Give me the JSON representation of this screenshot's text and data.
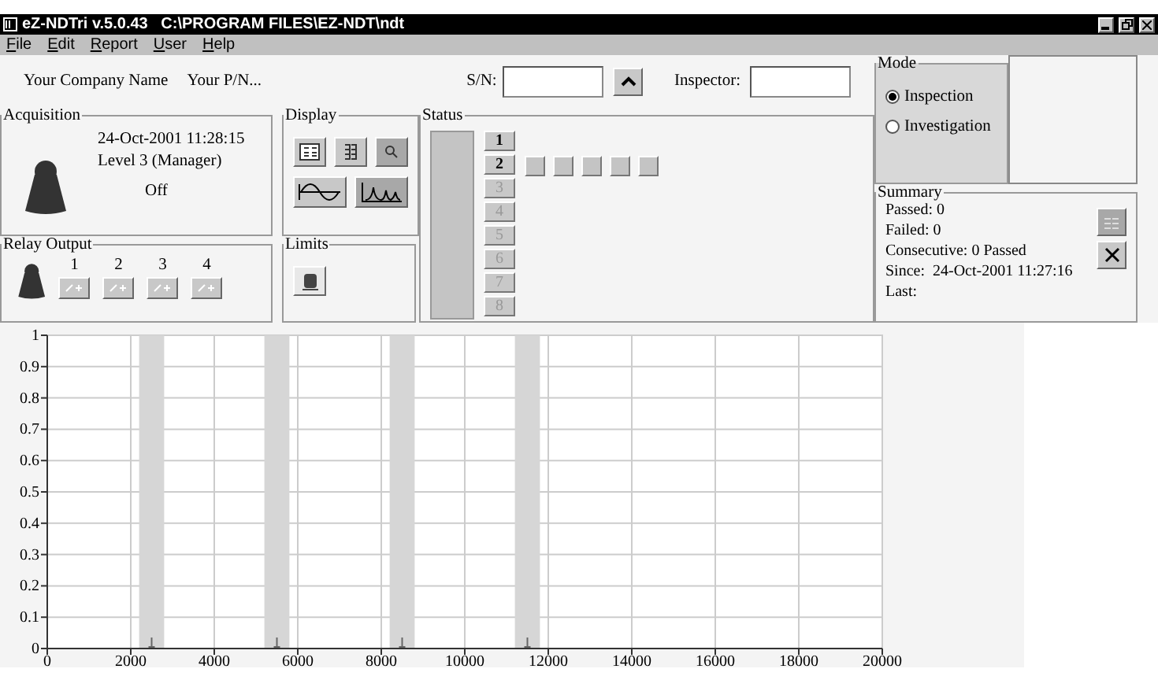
{
  "window": {
    "title": "eZ-NDTri v.5.0.43   C:\\PROGRAM FILES\\EZ-NDT\\ndt"
  },
  "menu": [
    {
      "label": "File"
    },
    {
      "label": "Edit"
    },
    {
      "label": "Report"
    },
    {
      "label": "User"
    },
    {
      "label": "Help"
    }
  ],
  "header": {
    "company": "Your Company Name",
    "part_number": "Your P/N...",
    "serial_label": "S/N:",
    "inspector_label": "Inspector:"
  },
  "acquisition": {
    "title": "Acquisition",
    "datetime": "24-Oct-2001 11:28:15",
    "level": "Level 3 (Manager)",
    "state": "Off"
  },
  "display": {
    "title": "Display"
  },
  "relay_output": {
    "title": "Relay Output",
    "relays": [
      "1",
      "2",
      "3",
      "4"
    ]
  },
  "limits": {
    "title": "Limits"
  },
  "status": {
    "title": "Status",
    "channels": [
      {
        "label": "1",
        "disabled": false
      },
      {
        "label": "2",
        "disabled": false
      },
      {
        "label": "3",
        "disabled": true
      },
      {
        "label": "4",
        "disabled": true
      },
      {
        "label": "5",
        "disabled": true
      },
      {
        "label": "6",
        "disabled": true
      },
      {
        "label": "7",
        "disabled": true
      },
      {
        "label": "8",
        "disabled": true
      }
    ]
  },
  "mode": {
    "title": "Mode",
    "options": [
      {
        "label": "Inspection",
        "selected": true
      },
      {
        "label": "Investigation",
        "selected": false
      }
    ]
  },
  "summary": {
    "title": "Summary",
    "lines": [
      "Passed: 0",
      "Failed: 0",
      "Consecutive: 0 Passed",
      "Since:  24-Oct-2001 11:27:16",
      "Last:"
    ]
  },
  "chart": {
    "chart_data": {
      "type": "line",
      "xlim": [
        0,
        20000
      ],
      "ylim": [
        0,
        1
      ],
      "xticks": [
        0,
        2000,
        4000,
        6000,
        8000,
        10000,
        12000,
        14000,
        16000,
        18000,
        20000
      ],
      "yticks": [
        0,
        0.1,
        0.2,
        0.3,
        0.4,
        0.5,
        0.6,
        0.7,
        0.8,
        0.9,
        1
      ],
      "grid": true,
      "bands": [
        {
          "axis": "x",
          "from": 2200,
          "to": 2800
        },
        {
          "axis": "x",
          "from": 5200,
          "to": 5800
        },
        {
          "axis": "x",
          "from": 8200,
          "to": 8800
        },
        {
          "axis": "x",
          "from": 11200,
          "to": 11800
        }
      ]
    }
  }
}
